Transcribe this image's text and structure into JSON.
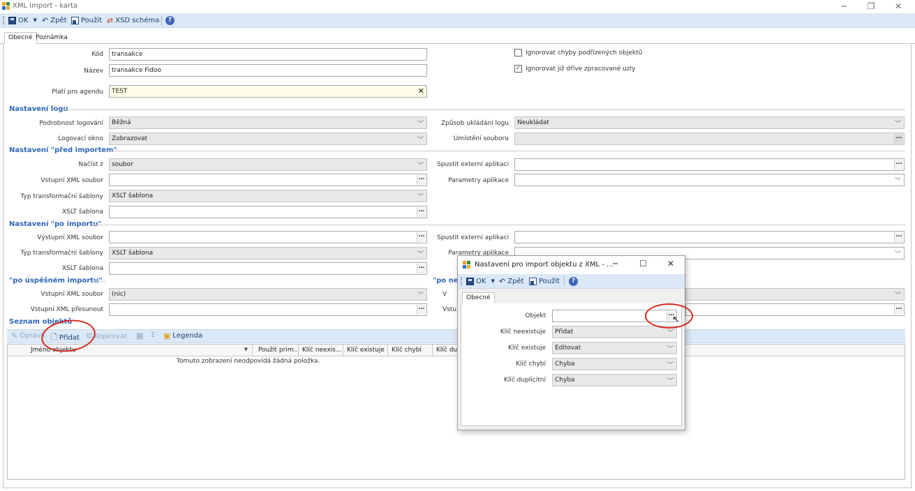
{
  "window": {
    "title": "XML import - karta"
  },
  "toolbar": {
    "ok": "OK",
    "back": "Zpět",
    "use": "Použít",
    "xsd": "XSD schéma"
  },
  "tabs": [
    "Obecné",
    "Poznámka"
  ],
  "form": {
    "kod_label": "Kód",
    "kod_value": "transakce",
    "nazev_label": "Název",
    "nazev_value": "transakce Fidoo",
    "agenda_label": "Platí pro agendu",
    "agenda_value": "TEST",
    "ignore_child_errors": "Ignorovat chyby podřízených objektů",
    "ignore_processed": "Ignorovat již dříve zpracované uzly"
  },
  "log_section": {
    "title": "Nastavení logu",
    "detail_label": "Podrobnost logování",
    "detail_value": "Běžná",
    "window_label": "Logovací okno",
    "window_value": "Zobrazovat",
    "save_label": "Způsob ukládání logu",
    "save_value": "Neukládat",
    "location_label": "Umístění souboru"
  },
  "before_section": {
    "title": "Nastavení \"před importem\"",
    "load_label": "Načíst z",
    "load_value": "soubor",
    "input_xml_label": "Vstupní XML soubor",
    "transform_type_label": "Typ transformační šablony",
    "transform_type_value": "XSLT šablona",
    "xslt_label": "XSLT šablona",
    "run_ext_label": "Spustit externí aplikaci",
    "app_params_label": "Parametry aplikace"
  },
  "after_section": {
    "title": "Nastavení \"po importu\"",
    "output_xml_label": "Výstupní XML soubor",
    "transform_type_label": "Typ transformační šablony",
    "transform_type_value": "XSLT šablona",
    "xslt_label": "XSLT šablona",
    "run_ext_label": "Spustit externí aplikaci",
    "app_params_label": "Parametry aplikace"
  },
  "success_section": {
    "title": "\"po úspěšném importu\"",
    "title_right": "\"po neú",
    "input_xml_label": "Vstupní XML soubor",
    "input_xml_value": "(nic)",
    "move_label": "Vstupní XML přesunout",
    "right_label1": "V",
    "right_label2": "Vstu"
  },
  "objects": {
    "title": "Seznam objektů",
    "edit": "Opravit",
    "add": "Přidat",
    "copy": "Kopírovat",
    "legend": "Legenda",
    "sigma": "Σ",
    "columns": [
      "Jméno objektu",
      "Použít prim...",
      "Klíč neexis...",
      "Klíč existuje",
      "Klíč chybí",
      "Klíč du"
    ],
    "empty": "Tomuto zobrazení neodpovídá žádná položka."
  },
  "dialog": {
    "title": "Nastavení pro import objektu z XML - ...",
    "ok": "OK",
    "back": "Zpět",
    "use": "Použít",
    "tab": "Obecné",
    "objekt_label": "Objekt",
    "missing_label": "Klíč neexistuje",
    "missing_value": "Přidat",
    "exists_label": "Klíč existuje",
    "exists_value": "Editovat",
    "absent_label": "Klíč chybí",
    "absent_value": "Chyba",
    "dup_label": "Klíč duplicitní",
    "dup_value": "Chyba"
  },
  "colors": {
    "section": "#2e67b8",
    "toolbar": "#dbe8f7",
    "highlight": "#d6271d"
  }
}
